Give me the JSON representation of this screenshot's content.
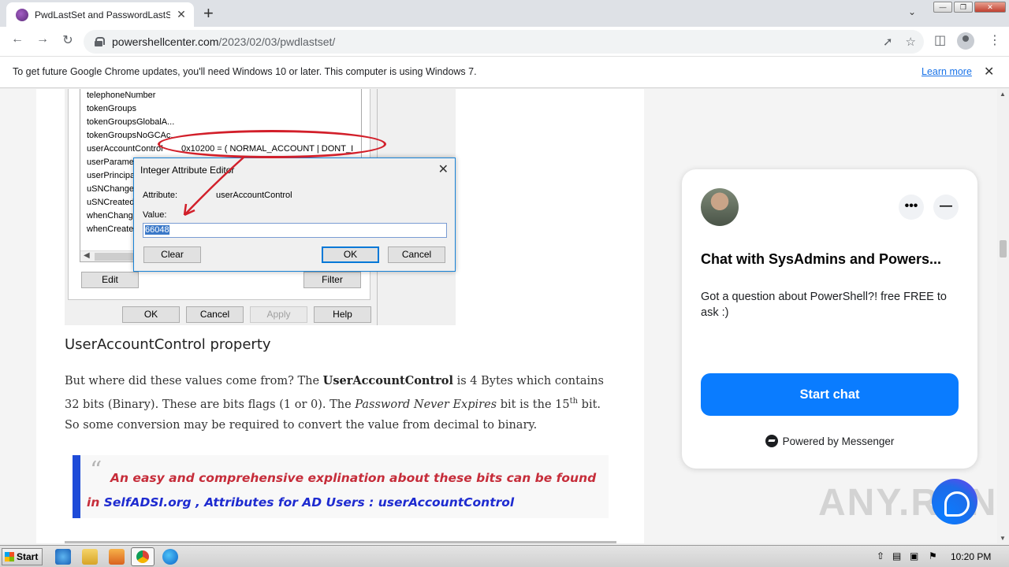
{
  "browser": {
    "tab_title": "PwdLastSet and PasswordLastSe",
    "tab_close": "✕",
    "new_tab": "+",
    "url_host": "powershellcenter.com",
    "url_path": "/2023/02/03/pwdlastset/"
  },
  "infobar": {
    "message": "To get future Google Chrome updates, you'll need Windows 10 or later. This computer is using Windows 7.",
    "link": "Learn more"
  },
  "screenshot": {
    "rows": [
      "telephoneNumber",
      "tokenGroups",
      "tokenGroupsGlobalA...",
      "tokenGroupsNoGCAc...",
      "userAccountControl",
      "userParamet",
      "userPrincipal",
      "uSNChange",
      "uSNCreated",
      "whenChange",
      "whenCreated"
    ],
    "uac_value": "0x10200 = ( NORMAL_ACCOUNT | DONT_I",
    "edit_button": "Edit",
    "filter_button": "Filter",
    "ok_button": "OK",
    "cancel_button": "Cancel",
    "apply_button": "Apply",
    "help_button": "Help",
    "dialog": {
      "title": "Integer Attribute Editor",
      "attribute_label": "Attribute:",
      "attribute_value": "userAccountControl",
      "value_label": "Value:",
      "value": "66048",
      "clear_button": "Clear",
      "ok_button": "OK",
      "cancel_button": "Cancel"
    }
  },
  "article": {
    "heading": "UserAccountControl property",
    "para_1": "But where did these values come from? The ",
    "para_bold": "UserAccountControl",
    "para_2": " is 4 Bytes which contains 32 bits (Binary). These are bits flags (1 or 0). The ",
    "para_italic": "Password Never Expires",
    "para_3": " bit is the 15",
    "para_sup": "th",
    "para_4": " bit. So some conversion may be required to convert the value from decimal to binary.",
    "quote_text": "An easy and comprehensive explination about these bits can be found in ",
    "quote_link": "SelfADSI.org , Attributes for AD Users : userAccountControl"
  },
  "chat": {
    "title": "Chat with SysAdmins and Powers...",
    "description": "Got a question about PowerShell?! free FREE to ask :)",
    "more_button": "•••",
    "minimize_button": "—",
    "start_button": "Start chat",
    "powered_by": "Powered by Messenger"
  },
  "watermark": "ANY.RUN",
  "taskbar": {
    "start_label": "Start",
    "clock": "10:20 PM"
  },
  "colors": {
    "accent_blue": "#0a7cff",
    "quote_red": "#c62d3a",
    "quote_link_blue": "#1e2bd0",
    "ellipse_red": "#d21f2a"
  }
}
